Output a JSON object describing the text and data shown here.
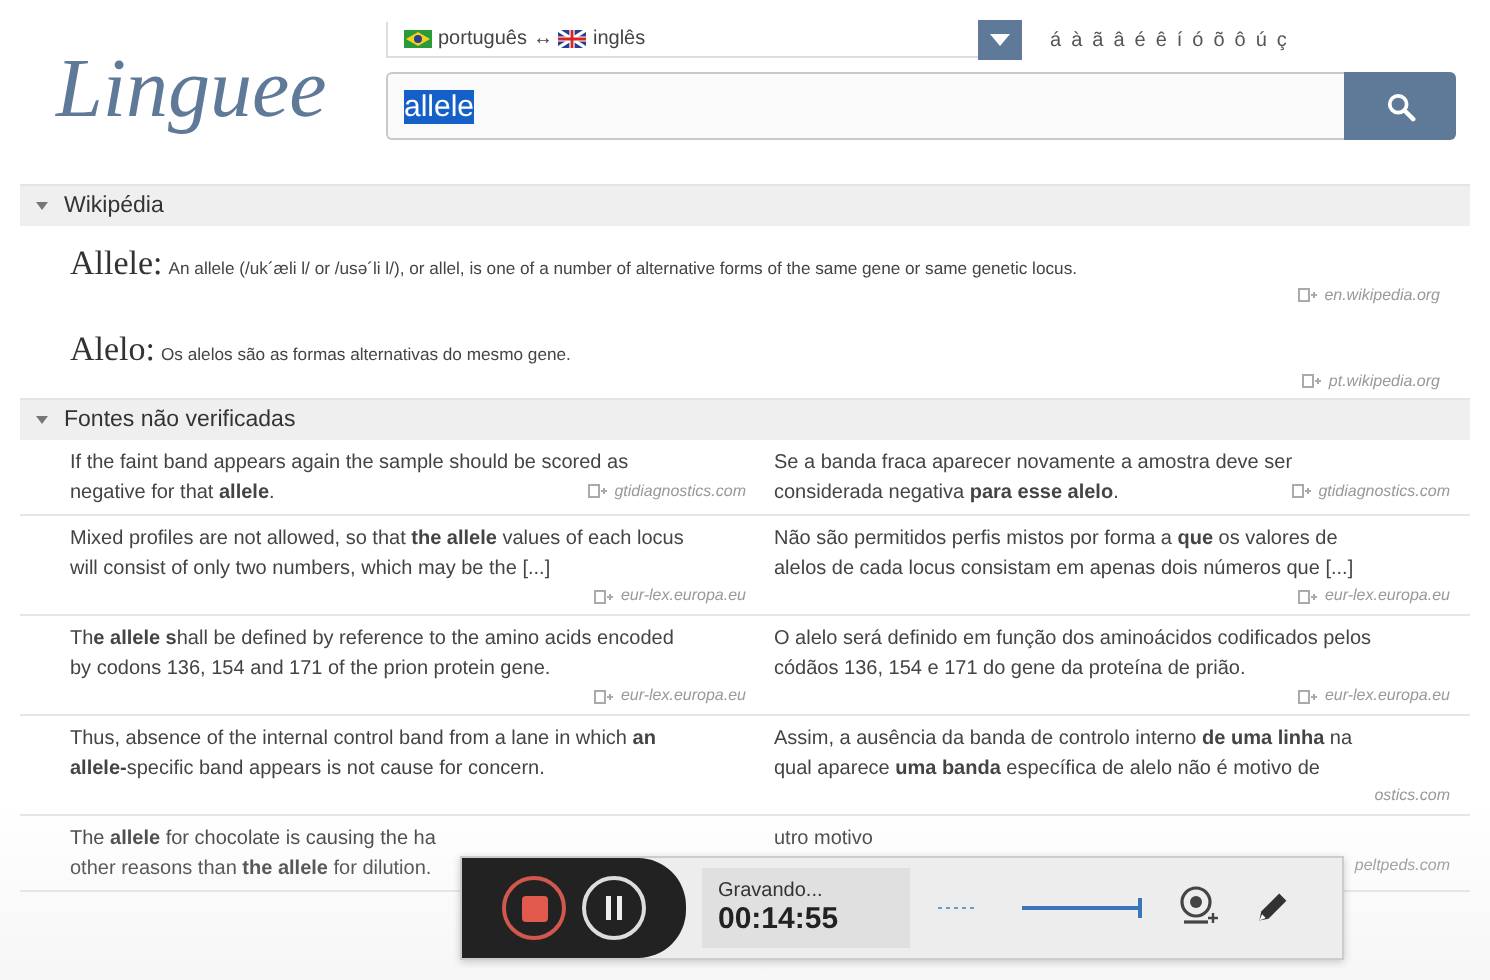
{
  "header": {
    "logo": "Linguee",
    "language_pair": {
      "source": "português",
      "arrow": "↔",
      "target": "inglês"
    },
    "special_chars": [
      "á",
      "à",
      "ã",
      "â",
      "é",
      "ê",
      "í",
      "ó",
      "õ",
      "ô",
      "ú",
      "ç"
    ],
    "search": {
      "value": "allele"
    }
  },
  "wikipedia": {
    "title": "Wikipédia",
    "expanded": true,
    "entries": [
      {
        "term": "Allele:",
        "definition": "An allele (/uk´æli l/ or /usə´li l/), or allel, is one of a number of alternative forms of the same gene or same genetic locus.",
        "source": "en.wikipedia.org"
      },
      {
        "term": "Alelo:",
        "definition": "Os alelos são as formas alternativas do mesmo gene.",
        "source": "pt.wikipedia.org"
      }
    ]
  },
  "unverified": {
    "title": "Fontes não verificadas",
    "expanded": true,
    "rows": [
      {
        "left": {
          "lines": [
            "If the faint band appears again the sample should be scored as",
            "negative for that **allele**."
          ],
          "source": "gtidiagnostics.com",
          "source_inline": true
        },
        "right": {
          "lines": [
            "Se a banda fraca aparecer novamente a amostra deve ser",
            "considerada negativa **para esse alelo**."
          ],
          "source": "gtidiagnostics.com",
          "source_inline": true
        }
      },
      {
        "left": {
          "lines": [
            "Mixed profiles are not allowed, so that **the allele** values of each locus",
            "will consist of only two numbers, which may be the [...]"
          ],
          "source": "eur-lex.europa.eu",
          "source_inline": false
        },
        "right": {
          "lines": [
            "Não são permitidos perfis mistos por forma a **que** os valores de",
            "alelos de cada locus consistam em apenas dois números que [...]"
          ],
          "source": "eur-lex.europa.eu",
          "source_inline": false
        }
      },
      {
        "left": {
          "lines": [
            "Th**e allele s**hall be defined by reference to the amino acids encoded",
            "by codons 136, 154 and 171 of the prion protein gene."
          ],
          "source": "eur-lex.europa.eu",
          "source_inline": false
        },
        "right": {
          "lines": [
            "O alelo será definido em função dos aminoácidos codificados pelos",
            "códãos 136, 154 e 171 do gene da proteína de prião."
          ],
          "source": "eur-lex.europa.eu",
          "source_inline": false
        }
      },
      {
        "left": {
          "lines": [
            "Thus, absence of the internal control band from a lane in which **an**",
            "**allele-**specific band appears is not cause for concern."
          ]
        },
        "right": {
          "lines": [
            "Assim, a ausência da banda de controlo interno **de uma linha** na",
            "qual aparece **uma banda** específica de alelo não é motivo de"
          ],
          "source": "ostics.com",
          "source_inline": false
        }
      },
      {
        "left": {
          "lines": [
            "The **allele** for chocolate is causing the ha",
            "other reasons than **the allele** for dilution."
          ]
        },
        "right": {
          "lines": [
            "utro motivo"
          ],
          "source": "peltpeds.com",
          "source_inline": false
        }
      }
    ]
  },
  "recorder": {
    "status": "Gravando...",
    "time": "00:14:55",
    "volume": {
      "level": 1
    }
  }
}
